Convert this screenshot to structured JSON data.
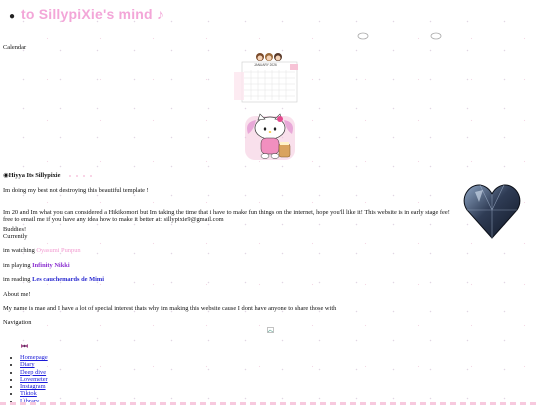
{
  "header": {
    "title": "to SillypiXie's mind ♪",
    "icon": "camera-icon"
  },
  "calendar": {
    "label": "Calendar",
    "month": "JANUARY 2026"
  },
  "intro": {
    "heading": "Hiyya Its Sillypixie",
    "line1": "Im doing my best not destroying this beautiful template !",
    "paragraph": "Im 20 and Im what you can considered a Hikikomori but Im taking the time that i have to make fun things on the internet, hope you'll like it! This website is in early stage fee! free to email me if you have any idea how to make it better at: sillypixie9@gmail.com",
    "buddies": "Buddies!",
    "currently": "Currently"
  },
  "currently": {
    "watching_prefix": "im watching ",
    "watching": "Oyasumi Punpun",
    "playing_prefix": "im playing ",
    "playing": "Infinity Nikki",
    "reading_prefix": "im reading ",
    "reading": "Les cauchemards de Mimi"
  },
  "about": {
    "label": "About me!",
    "text": "My name is mae and I have a lot of special interest thats why im making this website cause I dont have anyone to share those with"
  },
  "navigation": {
    "label": "Navigation",
    "items": [
      "Homepage",
      "Diary",
      "Deep dive",
      "Lovemeter",
      "Instagram",
      "Tiktok",
      "Library"
    ]
  },
  "colors": {
    "accent_pink": "#f3a6d8",
    "link_blue": "#1a1ad8",
    "heart": "#2f3c55"
  }
}
